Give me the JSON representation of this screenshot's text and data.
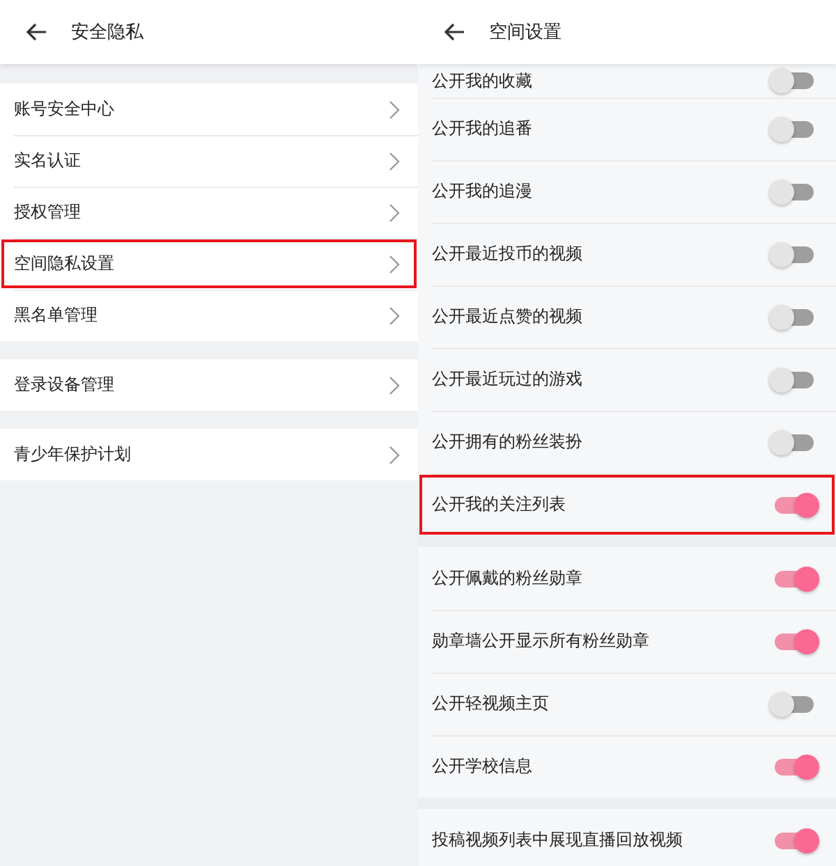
{
  "left_panel": {
    "title": "安全隐私",
    "groups": [
      {
        "items": [
          {
            "label": "账号安全中心",
            "highlighted": false
          },
          {
            "label": "实名认证",
            "highlighted": false
          },
          {
            "label": "授权管理",
            "highlighted": false
          },
          {
            "label": "空间隐私设置",
            "highlighted": true
          },
          {
            "label": "黑名单管理",
            "highlighted": false
          }
        ]
      },
      {
        "items": [
          {
            "label": "登录设备管理",
            "highlighted": false
          }
        ]
      },
      {
        "items": [
          {
            "label": "青少年保护计划",
            "highlighted": false
          }
        ]
      }
    ]
  },
  "right_panel": {
    "title": "空间设置",
    "groups": [
      {
        "items": [
          {
            "label": "公开我的收藏",
            "on": false,
            "highlighted": false
          },
          {
            "label": "公开我的追番",
            "on": false,
            "highlighted": false
          },
          {
            "label": "公开我的追漫",
            "on": false,
            "highlighted": false
          },
          {
            "label": "公开最近投币的视频",
            "on": false,
            "highlighted": false
          },
          {
            "label": "公开最近点赞的视频",
            "on": false,
            "highlighted": false
          },
          {
            "label": "公开最近玩过的游戏",
            "on": false,
            "highlighted": false
          },
          {
            "label": "公开拥有的粉丝装扮",
            "on": false,
            "highlighted": false
          },
          {
            "label": "公开我的关注列表",
            "on": true,
            "highlighted": true
          }
        ]
      },
      {
        "items": [
          {
            "label": "公开佩戴的粉丝勋章",
            "on": true,
            "highlighted": false
          },
          {
            "label": "勋章墙公开显示所有粉丝勋章",
            "on": true,
            "highlighted": false
          },
          {
            "label": "公开轻视频主页",
            "on": false,
            "highlighted": false
          },
          {
            "label": "公开学校信息",
            "on": true,
            "highlighted": false
          }
        ]
      },
      {
        "items": [
          {
            "label": "投稿视频列表中展现直播回放视频",
            "on": true,
            "highlighted": false
          }
        ]
      }
    ]
  }
}
